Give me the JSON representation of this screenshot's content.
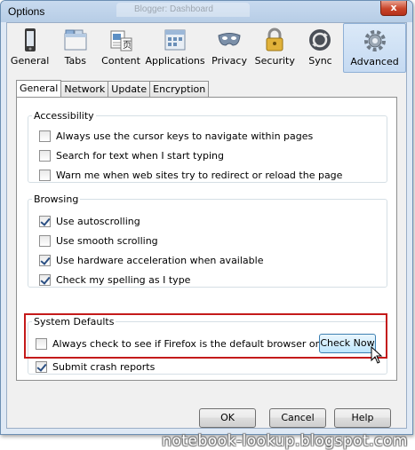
{
  "window": {
    "title": "Options",
    "background_tab_title": "Blogger: Dashboard",
    "close_glyph": "x"
  },
  "toolbar": {
    "panes": [
      {
        "id": "general",
        "label": "General",
        "icon": "general-icon"
      },
      {
        "id": "tabs",
        "label": "Tabs",
        "icon": "tabs-icon"
      },
      {
        "id": "content",
        "label": "Content",
        "icon": "content-icon"
      },
      {
        "id": "applications",
        "label": "Applications",
        "icon": "applications-icon"
      },
      {
        "id": "privacy",
        "label": "Privacy",
        "icon": "privacy-mask-icon"
      },
      {
        "id": "security",
        "label": "Security",
        "icon": "padlock-icon"
      },
      {
        "id": "sync",
        "label": "Sync",
        "icon": "sync-icon"
      },
      {
        "id": "advanced",
        "label": "Advanced",
        "icon": "gear-icon",
        "selected": true
      }
    ]
  },
  "subtabs": [
    "General",
    "Network",
    "Update",
    "Encryption"
  ],
  "sections": {
    "accessibility": {
      "legend": "Accessibility",
      "items": [
        {
          "label": "Always use the cursor keys to navigate within pages",
          "checked": false
        },
        {
          "label": "Search for text when I start typing",
          "checked": false
        },
        {
          "label": "Warn me when web sites try to redirect or reload the page",
          "checked": false
        }
      ]
    },
    "browsing": {
      "legend": "Browsing",
      "items": [
        {
          "label": "Use autoscrolling",
          "checked": true
        },
        {
          "label": "Use smooth scrolling",
          "checked": false
        },
        {
          "label": "Use hardware acceleration when available",
          "checked": true
        },
        {
          "label": "Check my spelling as I type",
          "checked": true
        }
      ]
    },
    "system_defaults": {
      "legend": "System Defaults",
      "default_browser_label": "Always check to see if Firefox is the default browser on startup",
      "default_browser_checked": false,
      "check_now_label": "Check Now",
      "crash_reports_label": "Submit crash reports",
      "crash_reports_checked": true
    }
  },
  "footer": {
    "ok_label": "OK",
    "cancel_label": "Cancel",
    "help_label": "Help"
  },
  "watermark": "notebook-lookup.blogspot.com",
  "colors": {
    "highlight_box": "#c41a1a",
    "selected_pane": "#c5daf2",
    "window_frame": "#dfe9f5"
  }
}
